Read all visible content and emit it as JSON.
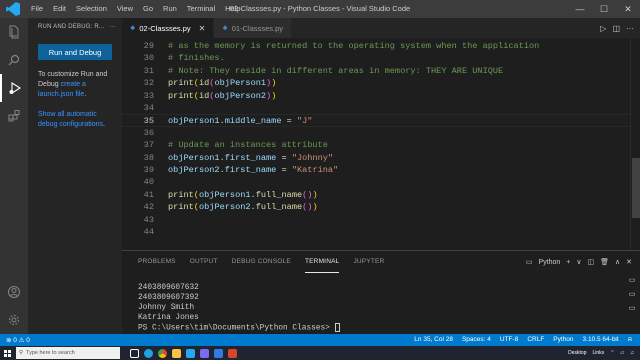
{
  "titlebar": {
    "menu": [
      "File",
      "Edit",
      "Selection",
      "View",
      "Go",
      "Run",
      "Terminal",
      "Help"
    ],
    "title": "02-Classses.py - Python Classes - Visual Studio Code",
    "controls": [
      "—",
      "☐",
      "✕"
    ]
  },
  "sidebar": {
    "header": "RUN AND DEBUG: R...",
    "header_more": "···",
    "run_button": "Run and Debug",
    "text1_a": "To customize Run and Debug ",
    "text1_link": "create a launch.json file",
    "text1_b": ".",
    "text2_link": "Show all automatic debug configurations",
    "text2_b": "."
  },
  "tabs": [
    {
      "icon": "py",
      "label": "02-Classses.py",
      "close": "✕",
      "active": true
    },
    {
      "icon": "py",
      "label": "01-Classses.py",
      "close": "",
      "active": false
    }
  ],
  "tab_actions": [
    "▷",
    "◫",
    "···"
  ],
  "code": [
    {
      "n": "29",
      "tokens": [
        [
          "c-comment",
          "# as the memory is returned to the operating system when the application"
        ]
      ]
    },
    {
      "n": "30",
      "tokens": [
        [
          "c-comment",
          "# finishes."
        ]
      ]
    },
    {
      "n": "31",
      "tokens": [
        [
          "c-comment",
          "# Note: They reside in different areas in memory: THEY ARE UNIQUE"
        ]
      ]
    },
    {
      "n": "32",
      "tokens": [
        [
          "c-fn",
          "print"
        ],
        [
          "c-paren1",
          "("
        ],
        [
          "c-fn",
          "id"
        ],
        [
          "c-paren2",
          "("
        ],
        [
          "c-var",
          "objPerson1"
        ],
        [
          "c-paren2",
          ")"
        ],
        [
          "c-paren1",
          ")"
        ]
      ]
    },
    {
      "n": "33",
      "tokens": [
        [
          "c-fn",
          "print"
        ],
        [
          "c-paren1",
          "("
        ],
        [
          "c-fn",
          "id"
        ],
        [
          "c-paren2",
          "("
        ],
        [
          "c-var",
          "objPerson2"
        ],
        [
          "c-paren2",
          ")"
        ],
        [
          "c-paren1",
          ")"
        ]
      ]
    },
    {
      "n": "34",
      "tokens": []
    },
    {
      "n": "35",
      "tokens": [
        [
          "c-var",
          "objPerson1"
        ],
        [
          "c-plain",
          "."
        ],
        [
          "c-var",
          "middle_name"
        ],
        [
          "c-plain",
          " = "
        ],
        [
          "c-str",
          "\"J\""
        ]
      ],
      "current": true
    },
    {
      "n": "36",
      "tokens": []
    },
    {
      "n": "37",
      "tokens": [
        [
          "c-comment",
          "# Update an instances attribute"
        ]
      ]
    },
    {
      "n": "38",
      "tokens": [
        [
          "c-var",
          "objPerson1"
        ],
        [
          "c-plain",
          "."
        ],
        [
          "c-var",
          "first_name"
        ],
        [
          "c-plain",
          " = "
        ],
        [
          "c-str",
          "\"Johnny\""
        ]
      ]
    },
    {
      "n": "39",
      "tokens": [
        [
          "c-var",
          "objPerson2"
        ],
        [
          "c-plain",
          "."
        ],
        [
          "c-var",
          "first_name"
        ],
        [
          "c-plain",
          " = "
        ],
        [
          "c-str",
          "\"Katrina\""
        ]
      ]
    },
    {
      "n": "40",
      "tokens": []
    },
    {
      "n": "41",
      "tokens": [
        [
          "c-fn",
          "print"
        ],
        [
          "c-paren1",
          "("
        ],
        [
          "c-var",
          "objPerson1"
        ],
        [
          "c-plain",
          "."
        ],
        [
          "c-fn",
          "full_name"
        ],
        [
          "c-paren2",
          "()"
        ],
        [
          "c-paren1",
          ")"
        ]
      ]
    },
    {
      "n": "42",
      "tokens": [
        [
          "c-fn",
          "print"
        ],
        [
          "c-paren1",
          "("
        ],
        [
          "c-var",
          "objPerson2"
        ],
        [
          "c-plain",
          "."
        ],
        [
          "c-fn",
          "full_name"
        ],
        [
          "c-paren2",
          "()"
        ],
        [
          "c-paren1",
          ")"
        ]
      ]
    },
    {
      "n": "43",
      "tokens": []
    },
    {
      "n": "44",
      "tokens": []
    }
  ],
  "panel": {
    "tabs": [
      "PROBLEMS",
      "OUTPUT",
      "DEBUG CONSOLE",
      "TERMINAL",
      "JUPYTER"
    ],
    "active_tab": "TERMINAL",
    "shell": "Python",
    "actions": [
      "+",
      "∨",
      "◫",
      "🗑",
      "∧",
      "✕"
    ],
    "terminal_lines": [
      "2403809607632",
      "2403809607392",
      "Johnny Smith",
      "Katrina Jones"
    ],
    "prompt": "PS C:\\Users\\tim\\Documents\\Python Classes> "
  },
  "statusbar": {
    "left": [
      "⊗ 0 ⚠ 0"
    ],
    "right": [
      "Ln 35, Col 28",
      "Spaces: 4",
      "UTF-8",
      "CRLF",
      "Python",
      "3.10.5 64-bit"
    ]
  },
  "taskbar": {
    "search_placeholder": "Type here to search",
    "tray": [
      "Desktop",
      "Links"
    ]
  },
  "colors": {
    "accent": "#007acc",
    "run_button": "#0e639c"
  }
}
